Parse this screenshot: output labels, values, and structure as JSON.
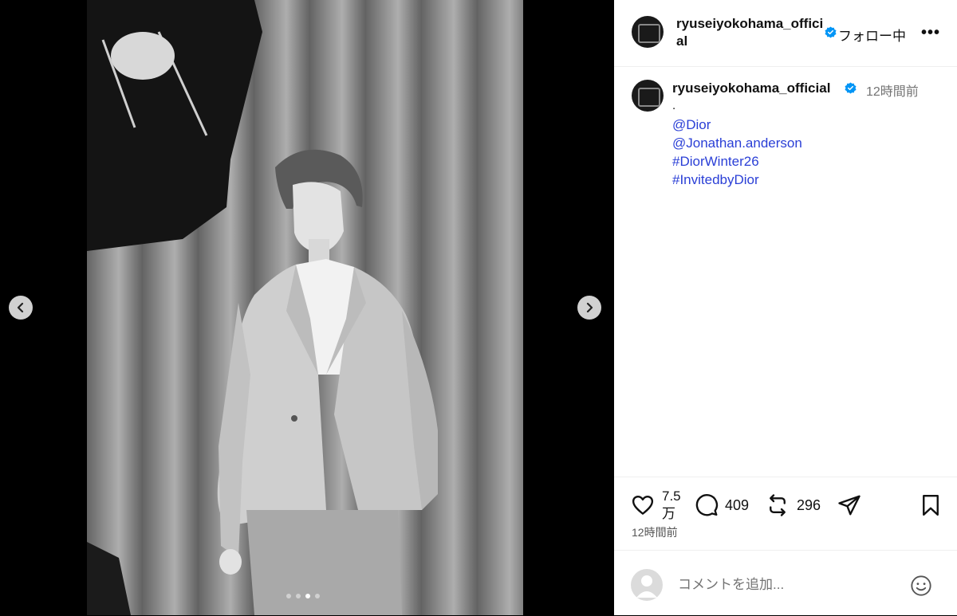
{
  "post": {
    "username": "ryuseiyokohama_official",
    "follow_label": "フォロー中",
    "more_label": "•••",
    "caption_dot": ".",
    "caption_time": "12時間前",
    "caption_links": [
      "@Dior",
      "@Jonathan.anderson",
      "#DiorWinter26",
      "#InvitedbyDior"
    ],
    "likes": "7.5万",
    "likes_line1": "7.5",
    "likes_line2": "万",
    "comments": "409",
    "reposts": "296",
    "post_time": "12時間前",
    "comment_placeholder": "コメントを追加..."
  },
  "carousel": {
    "slide_count": 4,
    "active_index": 2
  },
  "colors": {
    "verified": "#0095f6",
    "link": "#2a3fd6",
    "muted": "#737373"
  }
}
